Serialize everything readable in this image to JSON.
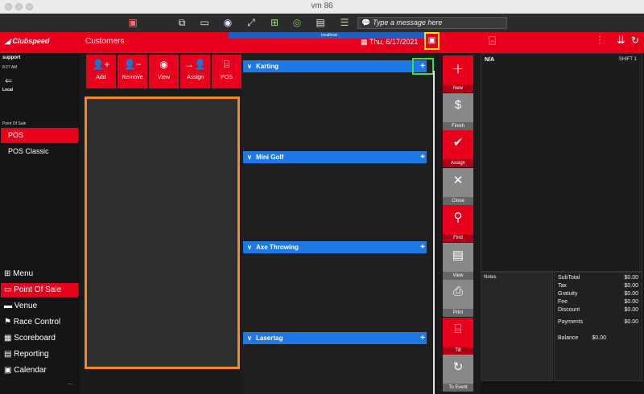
{
  "window": {
    "title": "vm 86"
  },
  "toolbar": {
    "message_placeholder": "Type a message here",
    "remote_title": "localhost"
  },
  "header": {
    "brand": "Clubspeed",
    "section_title": "Customers",
    "date": "Thu, 6/17/2021"
  },
  "leftnav": {
    "user": "support",
    "time": "8:27 AM",
    "location": "Local",
    "pos_header": "Point Of Sale",
    "pos_items": [
      "POS",
      "POS Classic"
    ],
    "bottom": [
      "Menu",
      "Point Of Sale",
      "Venue",
      "Race Control",
      "Scoreboard",
      "Reporting",
      "Calendar"
    ],
    "more": "..."
  },
  "customer_buttons": [
    "Add",
    "Remove",
    "View",
    "Assign",
    "POS"
  ],
  "categories": [
    "Karting",
    "Mini Golf",
    "Axe Throwing",
    "Lasertag"
  ],
  "actions": [
    {
      "label": "New",
      "icon": "plus-icon",
      "color": "#e8001d"
    },
    {
      "label": "Finish",
      "icon": "dollar-icon",
      "color": "#888888"
    },
    {
      "label": "Assign",
      "icon": "assign-icon",
      "color": "#e8001d"
    },
    {
      "label": "Close",
      "icon": "close-icon",
      "color": "#888888"
    },
    {
      "label": "Find",
      "icon": "search-icon",
      "color": "#e8001d"
    },
    {
      "label": "View",
      "icon": "document-icon",
      "color": "#888888"
    },
    {
      "label": "Print",
      "icon": "printer-icon",
      "color": "#888888"
    },
    {
      "label": "Till",
      "icon": "register-icon",
      "color": "#e8001d"
    },
    {
      "label": "To Event",
      "icon": "refresh-icon",
      "color": "#888888"
    }
  ],
  "ticket": {
    "customer": "N/A",
    "shift": "SHIFT 1",
    "notes_label": "Notes",
    "totals": [
      {
        "label": "SubTotal",
        "value": "$0.00"
      },
      {
        "label": "Tax",
        "value": "$0.00"
      },
      {
        "label": "Gratuity",
        "value": "$0.00"
      },
      {
        "label": "Fee",
        "value": "$0.00"
      },
      {
        "label": "Discount",
        "value": "$0.00"
      },
      {
        "label": "Payments",
        "value": "$0.00"
      },
      {
        "label": "Balance",
        "value": "$0.00"
      }
    ]
  },
  "colors": {
    "brand_red": "#e8001d",
    "category_blue": "#1e78e6",
    "highlight_orange": "#f48b1f",
    "highlight_yellow": "#f2e600",
    "highlight_green": "#3de04a"
  }
}
